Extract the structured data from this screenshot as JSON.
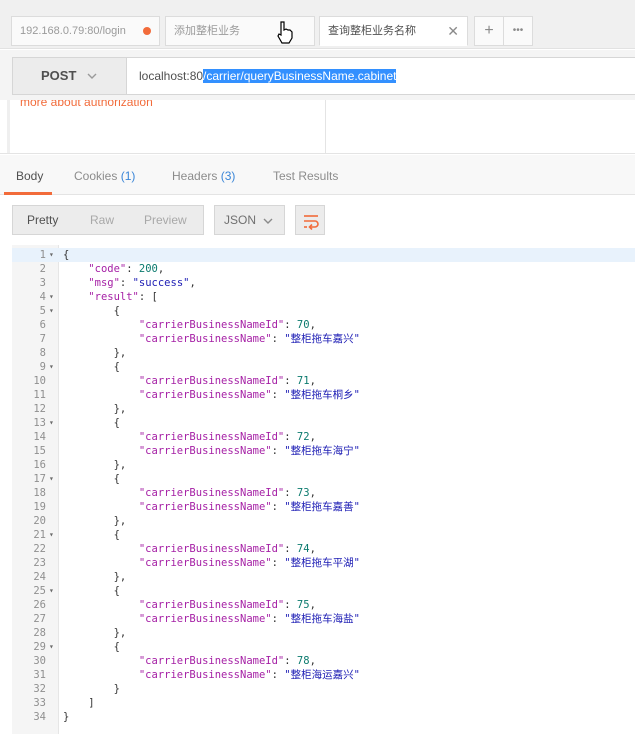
{
  "tabs": [
    {
      "label": "192.168.0.79:80/login",
      "state": "unsaved"
    },
    {
      "label": "添加整柜业务",
      "state": "normal"
    },
    {
      "label": "查询整柜业务名称",
      "state": "active"
    }
  ],
  "tab_buttons": {
    "add": "+",
    "more": "•••"
  },
  "request": {
    "method": "POST",
    "url_host": "localhost:80",
    "url_path": "/carrier/queryBusinessName.cabinet"
  },
  "upper_panel_text": "more about authorization",
  "response_tabs": [
    {
      "label": "Body",
      "count": ""
    },
    {
      "label": "Cookies",
      "count": "(1)"
    },
    {
      "label": "Headers",
      "count": "(3)"
    },
    {
      "label": "Test Results",
      "count": ""
    }
  ],
  "view_modes": {
    "pretty": "Pretty",
    "raw": "Raw",
    "preview": "Preview"
  },
  "format_select": "JSON",
  "response": {
    "code": 200,
    "msg": "success",
    "result": [
      {
        "carrierBusinessNameId": 70,
        "carrierBusinessName": "整柜拖车嘉兴"
      },
      {
        "carrierBusinessNameId": 71,
        "carrierBusinessName": "整柜拖车桐乡"
      },
      {
        "carrierBusinessNameId": 72,
        "carrierBusinessName": "整柜拖车海宁"
      },
      {
        "carrierBusinessNameId": 73,
        "carrierBusinessName": "整柜拖车嘉善"
      },
      {
        "carrierBusinessNameId": 74,
        "carrierBusinessName": "整柜拖车平湖"
      },
      {
        "carrierBusinessNameId": 75,
        "carrierBusinessName": "整柜拖车海盐"
      },
      {
        "carrierBusinessNameId": 78,
        "carrierBusinessName": "整柜海运嘉兴"
      }
    ]
  },
  "colors": {
    "accent": "#f26b3a",
    "count": "#3a86d8",
    "key": "#a51fa5",
    "string": "#1c1cb4",
    "number": "#0b7a6e"
  }
}
